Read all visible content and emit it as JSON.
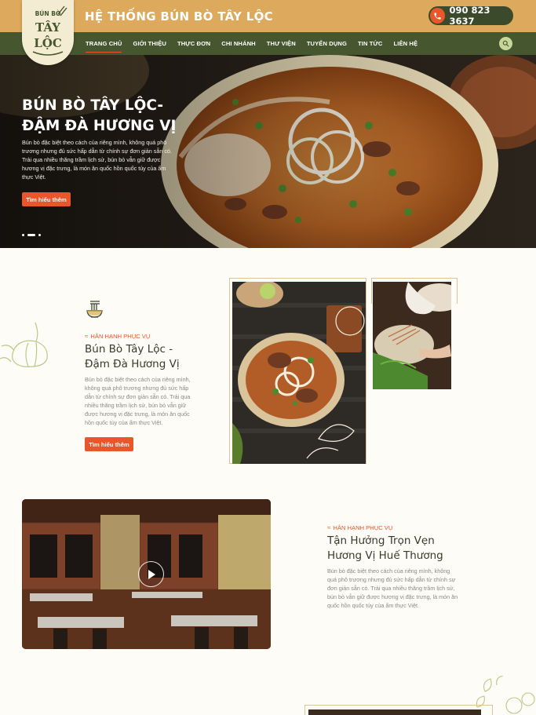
{
  "header": {
    "site_title": "HỆ THỐNG BÚN BÒ TÂY LỘC",
    "phone": "090 823 3637",
    "logo_text_top": "BÚN BÒ",
    "logo_text_main": "TÂY LỘC"
  },
  "nav": {
    "items": [
      "TRANG CHỦ",
      "GIỚI THIỆU",
      "THỰC ĐƠN",
      "CHI NHÁNH",
      "THƯ VIỆN",
      "TUYỂN DỤNG",
      "TIN TỨC",
      "LIÊN HỆ"
    ],
    "active_index": 0
  },
  "hero": {
    "title_line1": "BÚN BÒ TÂY LỘC-",
    "title_line2": "ĐẬM ĐÀ HƯƠNG VỊ",
    "description": "Bún bò đặc biệt theo cách của riêng mình, không quá phô trương nhưng đủ sức hấp dẫn từ chính sự đơn giản sẵn có. Trải qua nhiều thăng trầm lịch sử, bún bò vẫn giữ được hương vị đặc trưng, là món ăn quốc hồn quốc túy của ẩm thực Việt.",
    "button": "Tìm hiểu thêm"
  },
  "section1": {
    "subheading": "HÂN HẠNH PHỤC VỤ",
    "title_line1": "Bún Bò Tây Lộc -",
    "title_line2": "Đậm Đà Hương Vị",
    "description": "Bún bò đặc biệt theo cách của riêng mình, không quá phô trương nhưng đủ sức hấp dẫn từ chính sự đơn giản sẵn có. Trải qua nhiều thăng trầm lịch sử, bún bò vẫn giữ được hương vị đặc trưng, là món ăn quốc hồn quốc túy của ẩm thực Việt.",
    "button": "Tìm hiểu thêm"
  },
  "section2": {
    "subheading": "HÂN HẠNH PHỤC VỤ",
    "title_line1": "Tận Hưởng Trọn Vẹn",
    "title_line2": "Hương Vị Huế Thương",
    "description": "Bún bò đặc biệt theo cách của riêng mình, không quá phô trương nhưng đủ sức hấp dẫn từ chính sự đơn giản sẵn có. Trải qua nhiều thăng trầm lịch sử, bún bò vẫn giữ được hương vị đặc trưng, là món ăn quốc hồn quốc túy của ẩm thực Việt."
  },
  "colors": {
    "topbar": "#dda95c",
    "navbar": "#46562f",
    "accent": "#e8562a",
    "background": "#fdfcf7"
  },
  "icons": {
    "phone": "phone-icon",
    "search": "search-icon",
    "bowl": "noodle-bowl-icon",
    "play": "play-icon"
  }
}
